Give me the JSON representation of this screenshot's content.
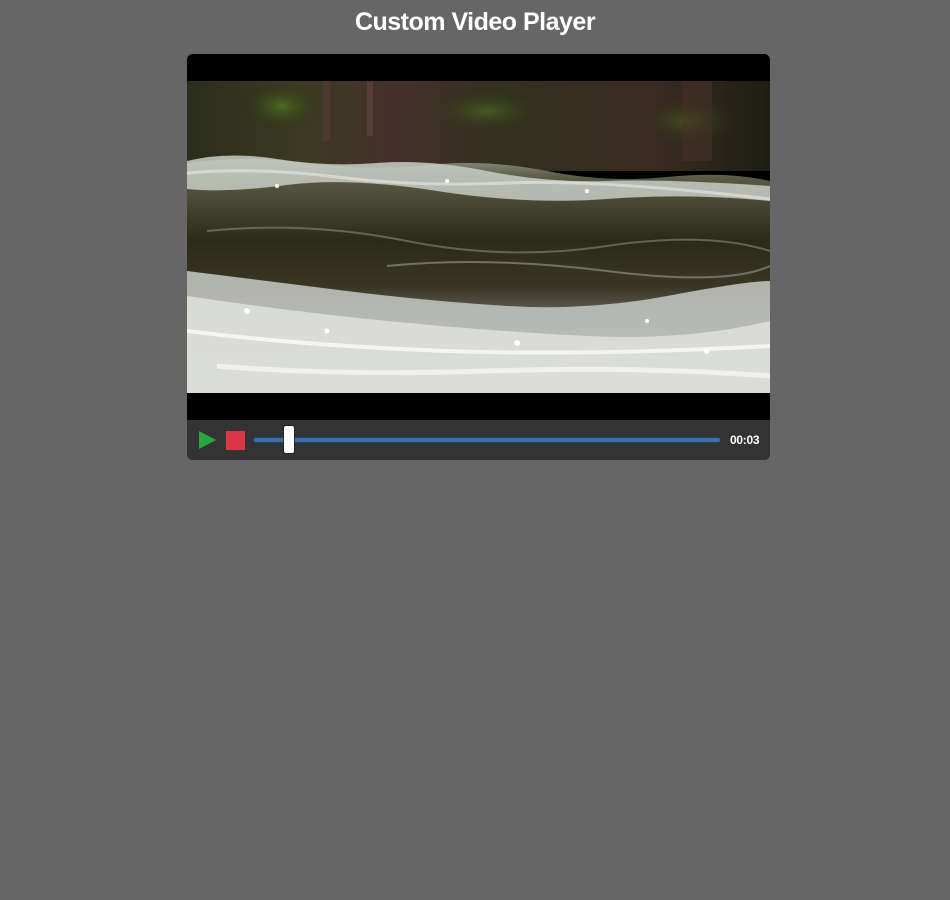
{
  "page": {
    "title": "Custom Video Player"
  },
  "player": {
    "video_content": "river-rapids-footage",
    "controls": {
      "play_icon": "play-icon",
      "stop_icon": "stop-icon",
      "progress_fraction": 0.077,
      "current_time": "00:03"
    }
  },
  "colors": {
    "page_background": "#666666",
    "player_background": "#000000",
    "controls_background": "#333333",
    "play": "#27a844",
    "stop": "#dc3545",
    "progress_track": "#3c6ea5",
    "handle": "#ffffff",
    "text": "#ffffff"
  }
}
